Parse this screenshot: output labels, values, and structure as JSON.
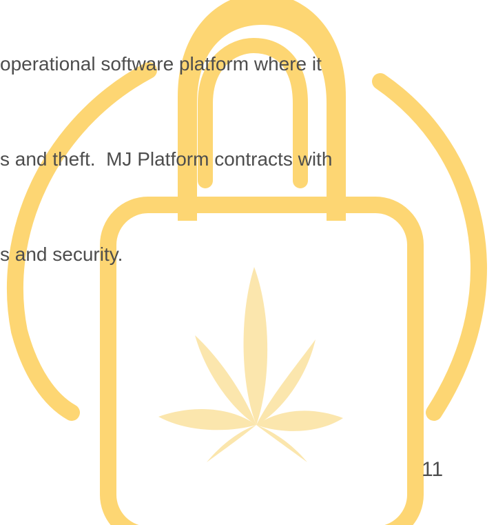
{
  "document": {
    "body_lines": [
      "operational software platform where it",
      "s and theft.  MJ Platform contracts with",
      "s and security."
    ],
    "page_number": "11"
  },
  "colors": {
    "illustration_stroke": "#fdd673",
    "leaf_fill": "#fbe6ad",
    "text": "#4d4d4d"
  },
  "icons": {
    "illustration": "cannabis-padlock-icon"
  }
}
